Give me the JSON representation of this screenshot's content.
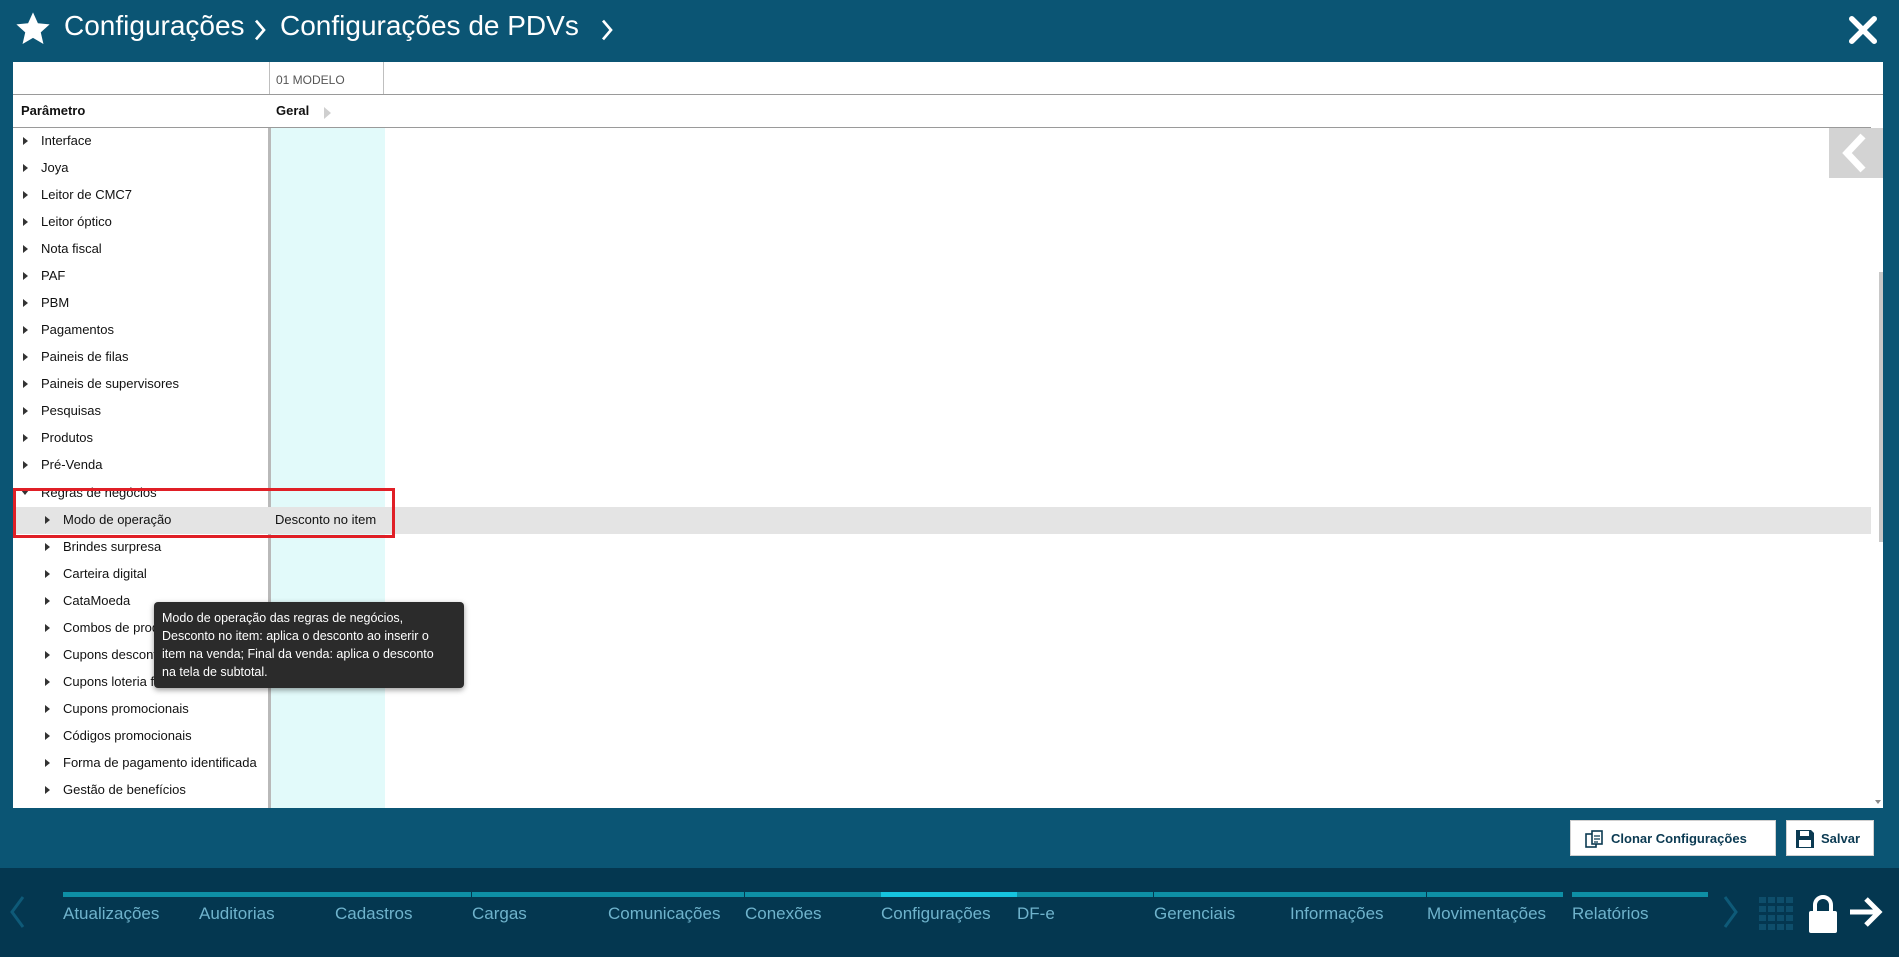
{
  "header": {
    "crumbs": [
      "Configurações",
      "Configurações de PDVs"
    ]
  },
  "table": {
    "model_column": "01 MODELO",
    "header_param": "Parâmetro",
    "header_geral": "Geral",
    "rows": [
      {
        "label": "Interface"
      },
      {
        "label": "Joya"
      },
      {
        "label": "Leitor de CMC7"
      },
      {
        "label": "Leitor óptico"
      },
      {
        "label": "Nota fiscal"
      },
      {
        "label": "PAF"
      },
      {
        "label": "PBM"
      },
      {
        "label": "Pagamentos"
      },
      {
        "label": "Paineis de filas"
      },
      {
        "label": "Paineis de supervisores"
      },
      {
        "label": "Pesquisas"
      },
      {
        "label": "Produtos"
      },
      {
        "label": "Pré-Venda"
      },
      {
        "label": "Regras de negócios"
      },
      {
        "label": "Modo de operação",
        "value": "Desconto no item"
      },
      {
        "label": "Brindes surpresa"
      },
      {
        "label": "Carteira digital"
      },
      {
        "label": "CataMoeda"
      },
      {
        "label": "Combos de produtos"
      },
      {
        "label": "Cupons descontos"
      },
      {
        "label": "Cupons loteria federal"
      },
      {
        "label": "Cupons promocionais"
      },
      {
        "label": "Códigos promocionais"
      },
      {
        "label": "Forma de pagamento identificada"
      },
      {
        "label": "Gestão de benefícios"
      }
    ]
  },
  "tooltip": {
    "lines": [
      "Modo de operação das regras de negócios,",
      "Desconto no item: aplica o desconto ao inserir o",
      "item na venda; Final da venda: aplica o desconto",
      "na tela de subtotal."
    ]
  },
  "buttons": {
    "clone": "Clonar Configurações",
    "save": "Salvar"
  },
  "footer": {
    "tabs": [
      "Atualizações",
      "Auditorias",
      "Cadastros",
      "Cargas",
      "Comunicações",
      "Conexões",
      "Configurações",
      "DF-e",
      "Gerenciais",
      "Informações",
      "Movimentações",
      "Relatórios"
    ],
    "active_tab": "Configurações"
  },
  "colors": {
    "header_bg": "#0b5574",
    "footer_bg": "#043750",
    "accent": "#16c4e0",
    "highlight_border": "#e01f26",
    "geral_column_bg": "#e2fafa"
  },
  "icons": [
    "star-icon",
    "chevron-right-icon",
    "close-icon",
    "chevron-left-icon",
    "triangle-right-icon",
    "triangle-down-icon",
    "clone-icon",
    "save-disk-icon",
    "grid-icon",
    "lock-icon",
    "arrow-right-icon"
  ]
}
